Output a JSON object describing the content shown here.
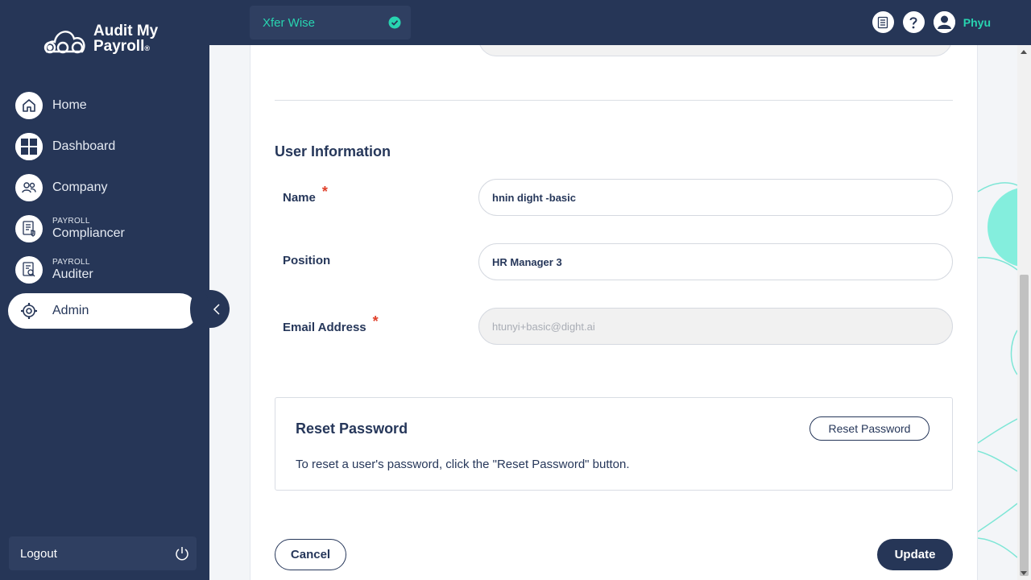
{
  "brand": {
    "line1": "Audit My",
    "line2": "Payroll",
    "reg": "®"
  },
  "sidebar": {
    "items": [
      {
        "label": "Home",
        "icon": "home-icon"
      },
      {
        "label": "Dashboard",
        "icon": "grid-icon"
      },
      {
        "label": "Company",
        "icon": "users-icon"
      },
      {
        "small": "PAYROLL",
        "label": "Compliancer",
        "icon": "document-shield-icon"
      },
      {
        "small": "PAYROLL",
        "label": "Auditer",
        "icon": "document-search-icon"
      },
      {
        "label": "Admin",
        "icon": "gear-icon",
        "active": true
      }
    ],
    "logout": "Logout"
  },
  "topbar": {
    "company": "Xfer Wise",
    "user": "Phyu"
  },
  "form": {
    "section_title": "User Information",
    "name_label": "Name",
    "name_value": "hnin dight -basic",
    "position_label": "Position",
    "position_value": "HR Manager 3",
    "email_label": "Email Address",
    "email_value": "htunyi+basic@dight.ai",
    "required_mark": "*"
  },
  "reset": {
    "title": "Reset Password",
    "description": "To reset a user's password, click the \"Reset Password\" button.",
    "button": "Reset Password"
  },
  "actions": {
    "cancel": "Cancel",
    "update": "Update"
  },
  "colors": {
    "navy": "#263657",
    "accent": "#28d4b0",
    "required": "#e0412b"
  }
}
